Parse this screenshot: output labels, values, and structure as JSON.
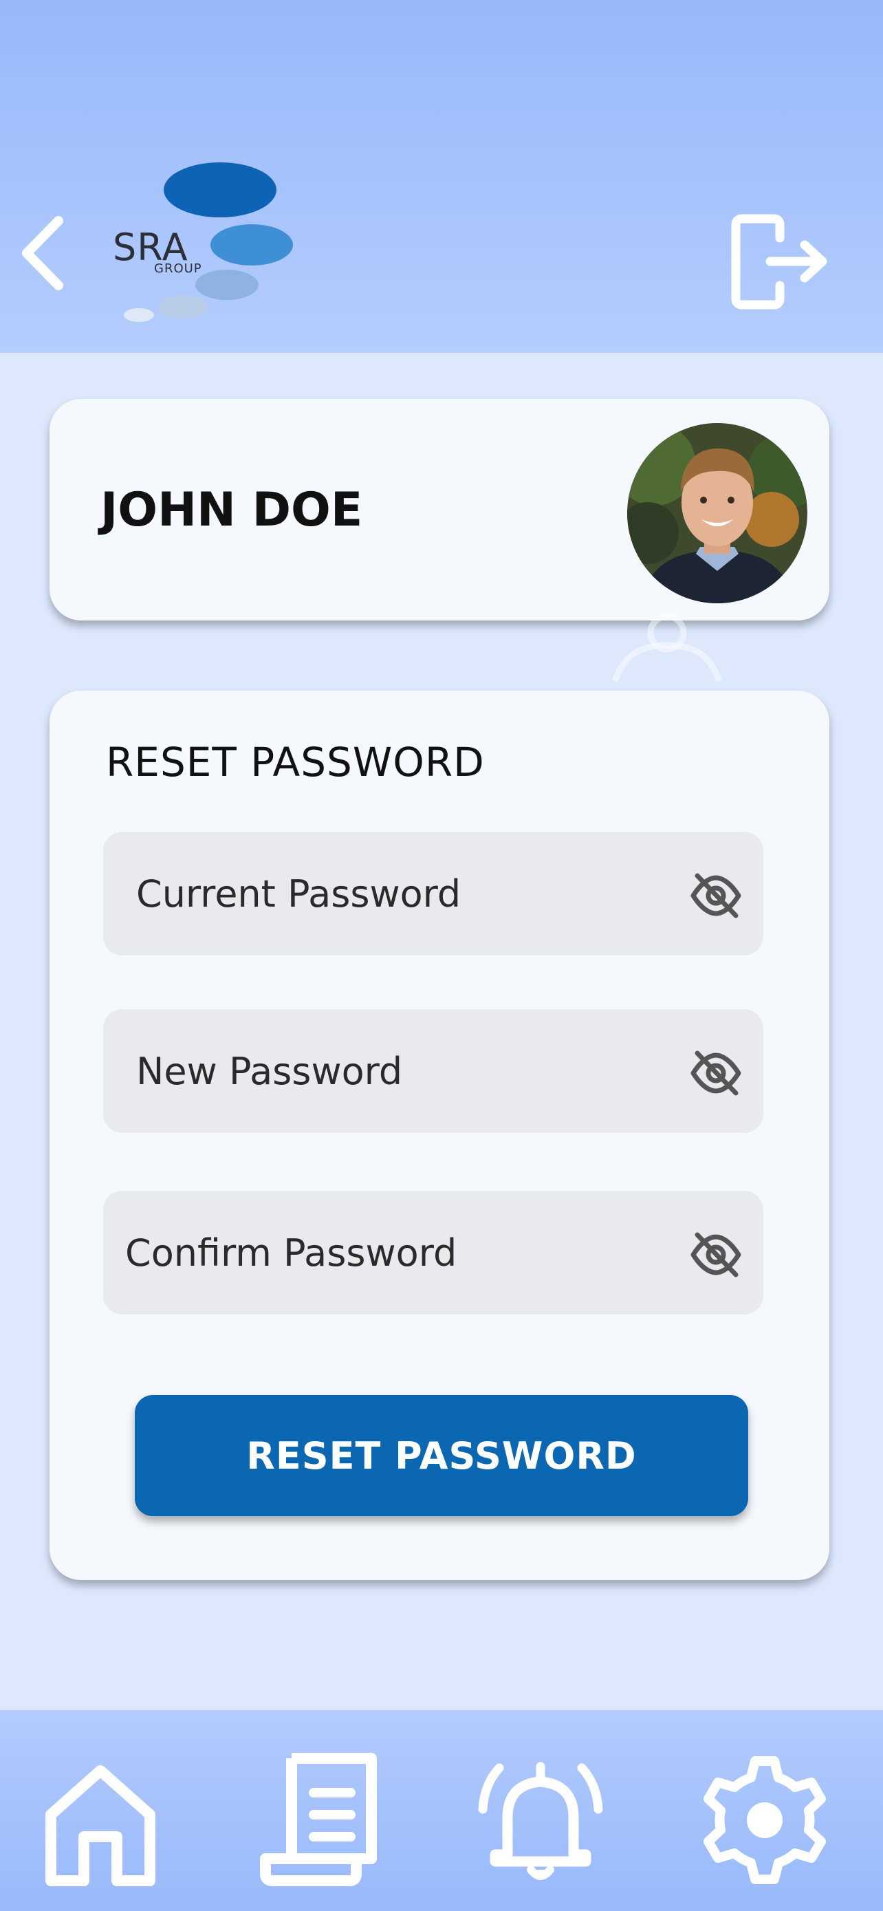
{
  "header": {
    "back_icon": "chevron-left-icon",
    "logo": {
      "text": "SRA",
      "subtext": "GROUP"
    },
    "logout_icon": "logout-icon"
  },
  "profile": {
    "name": "JOHN DOE",
    "avatar": "profile-photo"
  },
  "reset_form": {
    "title": "RESET PASSWORD",
    "fields": [
      {
        "placeholder": "Current Password",
        "icon": "eye-off-icon"
      },
      {
        "placeholder": "New Password",
        "icon": "eye-off-icon"
      },
      {
        "placeholder": "Confirm Password",
        "icon": "eye-off-icon"
      }
    ],
    "submit_label": "RESET PASSWORD"
  },
  "bottom_nav": {
    "items": [
      {
        "icon": "home-icon"
      },
      {
        "icon": "document-icon"
      },
      {
        "icon": "bell-icon"
      },
      {
        "icon": "gear-icon"
      }
    ]
  },
  "colors": {
    "header_bg": "#96b8fb",
    "page_bg": "#dde8fd",
    "card_bg": "#f5f8fd",
    "field_bg": "#e9eaee",
    "primary_button": "#0b67b1",
    "logo_dark_blue": "#0e63b5",
    "logo_mid_blue": "#3f8fd6"
  }
}
